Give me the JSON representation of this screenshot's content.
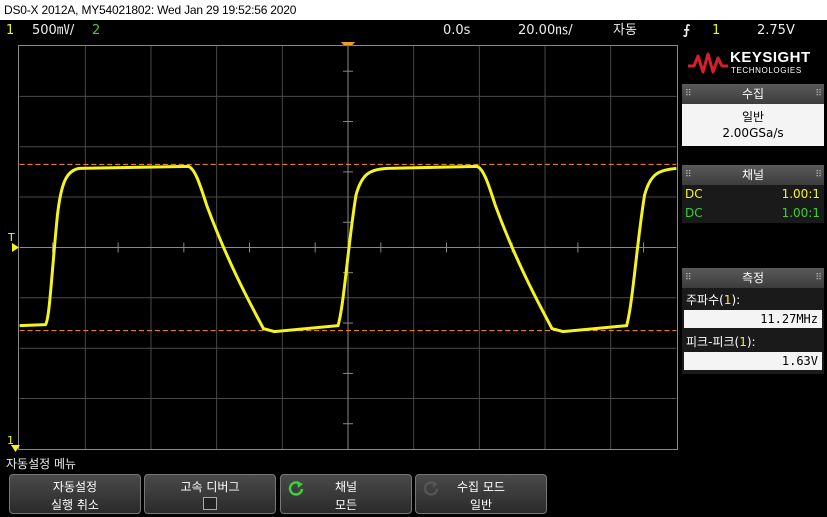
{
  "title": "DS0-X 2012A, MY54021802: Wed Jan 29 19:52:56 2020",
  "status": {
    "ch1_num": "1",
    "ch1_scale": "500",
    "ch1_unit": "㎷/",
    "ch2_num": "2",
    "time_offset": "0.0s",
    "timebase": "20.00",
    "timebase_unit": "㎱/",
    "trigger_mode": "자동",
    "trigger_slope": "⨍",
    "trigger_ch": "1",
    "trigger_level": "2.75V"
  },
  "brand": {
    "name": "KEYSIGHT",
    "sub": "TECHNOLOGIES"
  },
  "acquisition": {
    "header": "수집",
    "mode": "일반",
    "rate": "2.00GSa/s"
  },
  "channels": {
    "header": "채널",
    "rows": [
      {
        "coupling": "DC",
        "probe": "1.00:1",
        "color": "#f5f51e"
      },
      {
        "coupling": "DC",
        "probe": "1.00:1",
        "color": "#3ad13a"
      }
    ]
  },
  "measure": {
    "header": "측정",
    "items": [
      {
        "label_prefix": "주파수(",
        "ch": "1",
        "label_suffix": "):",
        "value": "11.27MHz"
      },
      {
        "label_prefix": "피크-피크(",
        "ch": "1",
        "label_suffix": "):",
        "value": "1.63V"
      }
    ]
  },
  "markers": {
    "trigger": "T",
    "ground": "1"
  },
  "softmenu": {
    "title": "자동설정 메뉴",
    "keys": [
      {
        "l1": "자동설정",
        "l2": "실행 취소"
      },
      {
        "l1": "고속 디버그",
        "l2": ""
      },
      {
        "l1": "채널",
        "l2": "모든"
      },
      {
        "l1": "수집 모드",
        "l2": "일반"
      }
    ]
  },
  "colors": {
    "ch1": "#f5f51e",
    "ch2": "#3ad13a",
    "cursor": "#e8820e",
    "accent": "#f0a020"
  }
}
